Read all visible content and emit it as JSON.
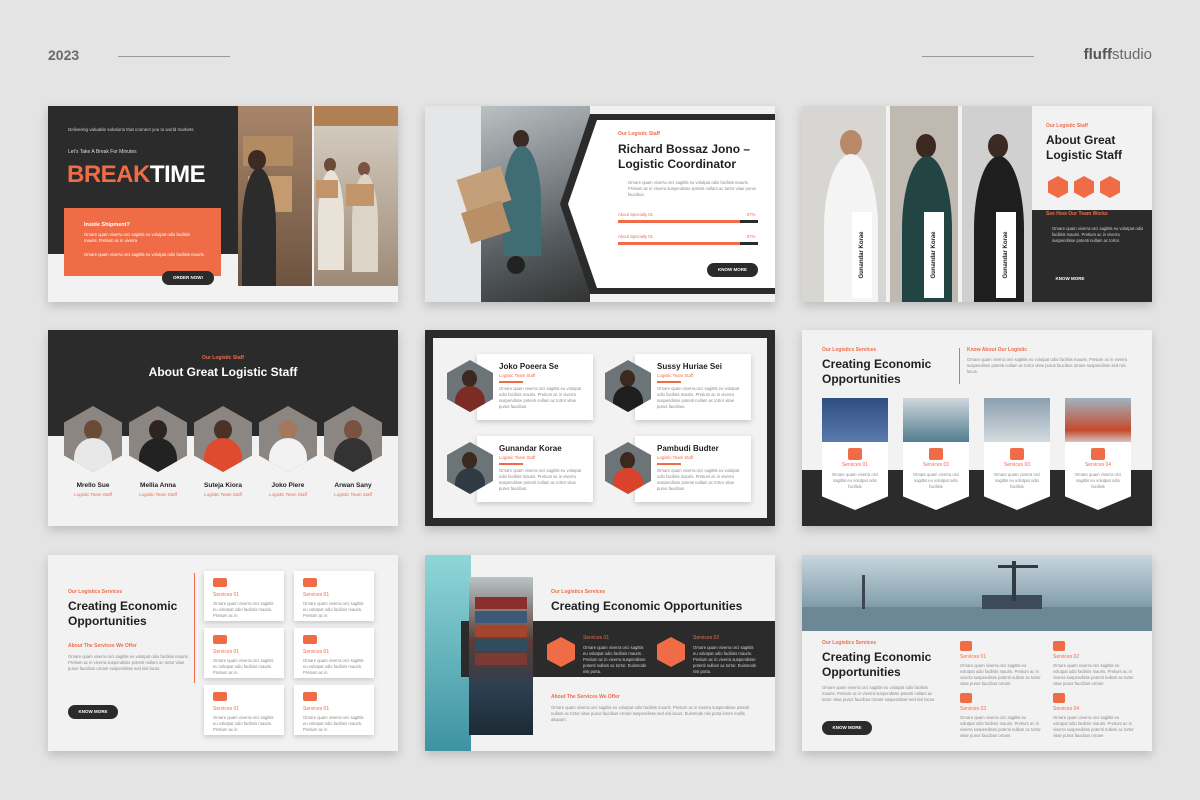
{
  "header": {
    "year": "2023",
    "brand_bold": "fluff",
    "brand_rest": "studio"
  },
  "colors": {
    "accent": "#ef6c47",
    "dark": "#2b2b2b",
    "light": "#f2f2f2"
  },
  "s1": {
    "tagline": "Delivering valuable solutions that connect you to world markets",
    "kicker": "Let's Take A Break For Minutes",
    "title_a": "BREAK",
    "title_b": "TIME",
    "box_title": "Inside Shipment?",
    "box_text": "Ornare quam viverra orci sagittis eu volutpat odio facilisis mauris. Pretium ac in viverra",
    "text": "Ornare quam viverra orci sagittis eu volutpat odio facilisis mauris.",
    "button": "ORDER NOW!"
  },
  "s2": {
    "label": "Our Logistic Staff",
    "name": "Richard Bossaz Jono –",
    "role": "Logistic Coordinator",
    "text": "Ornare quam viverra orci sagittis eu volutpat odio facilisis mauris. Pretium ac in viverra suspendisse potenti nullam ac tortor vitae purus faucibus.",
    "spec1": "About Specialty 01",
    "spec1_pct": "87%",
    "spec1_val": 0.87,
    "spec2": "About Specialty 01",
    "spec2_pct": "87%",
    "spec2_val": 0.87,
    "button": "KNOW MORE"
  },
  "s3": {
    "label": "Our Logistic Staff",
    "title1": "About Great",
    "title2": "Logistic Staff",
    "sub": "See How Our Team Works",
    "text": "Ornare quam viverra orci sagittis eu volutpat odio facilisis mauris. Pretium ac in viverra suspendisse potenti nullam ac tortor.",
    "button": "KNOW MORE",
    "people": [
      {
        "name": "Gunandar Korae",
        "role": "Logistic Team Staff"
      },
      {
        "name": "Gunandar Korae",
        "role": "Logistic Team Staff"
      },
      {
        "name": "Gunandar Korae",
        "role": "Logistic Team Staff"
      }
    ]
  },
  "s4": {
    "label": "Our Logistic Staff",
    "title": "About Great Logistic Staff",
    "people": [
      {
        "name": "Mrello Sue",
        "role": "Logistic Team Staff"
      },
      {
        "name": "Mellia Anna",
        "role": "Logistic Team Staff"
      },
      {
        "name": "Suteja Kiora",
        "role": "Logistic Team Staff"
      },
      {
        "name": "Joko Piere",
        "role": "Logistic Team Staff"
      },
      {
        "name": "Arwan Sany",
        "role": "Logistic Team Staff"
      }
    ]
  },
  "s5": {
    "text": "Ornare quam viverra orci sagittis eu volutpat odio facilisis mauris. Pretium ac in viverra suspendisse potenti nullam ac tortor vitae purus faucibus.",
    "people": [
      {
        "name": "Joko Poeera Se",
        "role": "Logistic Team Staff"
      },
      {
        "name": "Sussy Huriae Sei",
        "role": "Logistic Team Staff"
      },
      {
        "name": "Gunandar Korae",
        "role": "Logistic Team Staff"
      },
      {
        "name": "Pambudi Budter",
        "role": "Logistic Team Staff"
      }
    ]
  },
  "s6": {
    "label": "Our Logistics Services",
    "title1": "Creating Economic",
    "title2": "Opportunities",
    "right_label": "Know About Our Logistic",
    "right_text": "Ornare quam viverra orci sagittis eu volutpat odio facilisis mauris. Pretium ac in viverra suspendisse potenti nullam ac tortor vitae purus faucibus ornare suspendisse sed nisi lacus.",
    "services": [
      {
        "name": "Services 01",
        "text": "Ornare quam viverra orci sagittis eu volutpat odio facilisis"
      },
      {
        "name": "Services 03",
        "text": "Ornare quam viverra orci sagittis eu volutpat odio facilisis"
      },
      {
        "name": "Services 03",
        "text": "Ornare quam viverra orci sagittis eu volutpat odio facilisis"
      },
      {
        "name": "Services 04",
        "text": "Ornare quam viverra orci sagittis eu volutpat odio facilisis"
      }
    ]
  },
  "s7": {
    "label": "Our Logistics Services",
    "title1": "Creating Economic",
    "title2": "Opportunities",
    "sub": "About The Services We Offer",
    "text": "Ornare quam viverra orci sagittis eu volutpat odio facilisis mauris. Pretium ac in viverra suspendisse potenti nullam ac tortor vitae purus faucibus ornare suspendisse sed nisi lacus.",
    "button": "KNOW MORE",
    "services": [
      {
        "name": "Services 01",
        "text": "Ornare quam viverra orci sagittis eu volutpat odio facilisis mauris. Pretium ac in"
      },
      {
        "name": "Services 01",
        "text": "Ornare quam viverra orci sagittis eu volutpat odio facilisis mauris. Pretium ac in"
      },
      {
        "name": "Services 01",
        "text": "Ornare quam viverra orci sagittis eu volutpat odio facilisis mauris. Pretium ac in"
      },
      {
        "name": "Services 01",
        "text": "Ornare quam viverra orci sagittis eu volutpat odio facilisis mauris. Pretium ac in"
      },
      {
        "name": "Services 01",
        "text": "Ornare quam viverra orci sagittis eu volutpat odio facilisis mauris. Pretium ac in"
      },
      {
        "name": "Services 01",
        "text": "Ornare quam viverra orci sagittis eu volutpat odio facilisis mauris. Pretium ac in"
      }
    ]
  },
  "s8": {
    "label": "Our Logistics Services",
    "title": "Creating Economic Opportunities",
    "sub": "About The Services We Offer",
    "text": "Ornare quam viverra orci sagittis eu volutpat odio facilisis mauris. Pretium ac in viverra suspendisse potenti nullam ac tortor vitae purus faucibus ornare suspendisse sed nisi lacus. Euismode nisi porta lorem mollis aliquam.",
    "services": [
      {
        "name": "Services 01",
        "text": "Ornare quam viverra orci sagittis eu volutpat odio facilisis mauris. Pretium ac in viverra suspendisse potenti nullam ac tortor. Euismode nisi porta."
      },
      {
        "name": "Services 02",
        "text": "Ornare quam viverra orci sagittis eu volutpat odio facilisis mauris. Pretium ac in viverra suspendisse potenti nullam ac tortor. Euismode nisi porta."
      }
    ]
  },
  "s9": {
    "label": "Our Logistics Services",
    "title1": "Creating Economic",
    "title2": "Opportunities",
    "text": "Ornare quam viverra orci sagittis eu volutpat odio facilisis mauris. Pretium ac in viverra suspendisse potenti nullam ac tortor vitae purus faucibus ornare suspendisse sed nisi lacus.",
    "button": "KNOW MORE",
    "services": [
      {
        "name": "Services 01",
        "text": "Ornare quam viverra orci sagittis eu volutpat odio facilisis mauris. Pretium ac in viverra suspendisse potenti nullam ac tortor vitae purus faucibus ornare."
      },
      {
        "name": "Services 02",
        "text": "Ornare quam viverra orci sagittis eu volutpat odio facilisis mauris. Pretium ac in viverra suspendisse potenti nullam ac tortor vitae purus faucibus ornare."
      },
      {
        "name": "Services 03",
        "text": "Ornare quam viverra orci sagittis eu volutpat odio facilisis mauris. Pretium ac in viverra suspendisse potenti nullam ac tortor vitae purus faucibus ornare."
      },
      {
        "name": "Services 04",
        "text": "Ornare quam viverra orci sagittis eu volutpat odio facilisis mauris. Pretium ac in viverra suspendisse potenti nullam ac tortor vitae purus faucibus ornare."
      }
    ]
  }
}
